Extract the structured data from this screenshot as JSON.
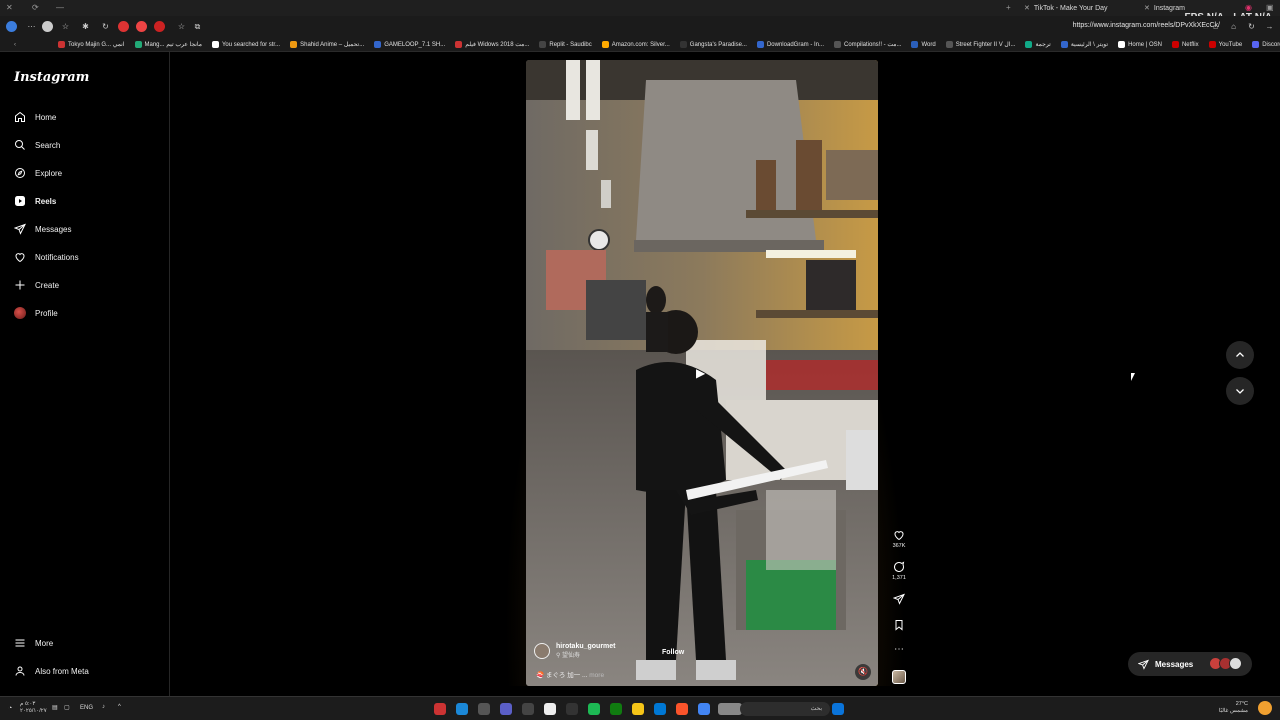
{
  "browser": {
    "tabs": [
      {
        "title": "TikTok - Make Your Day"
      },
      {
        "title": "Instagram"
      }
    ],
    "fps_label": "FPS",
    "fps_value": "N/A",
    "lat_label": "LAT",
    "lat_value": "N/A",
    "url": "https://www.instagram.com/reels/DPvXkXEcCk/",
    "bookmarks": [
      "Tokyo Majin G... انمي",
      "Mang... مانجا عرب تيم",
      "You searched for str...",
      "Shahid Anime – تحميل...",
      "GAMELOOP_7.1 SH...",
      "فيلم Widows 2018 مت...",
      "Replit - Saudibc",
      "Amazon.com: Silver...",
      "Gangsta's Paradise...",
      "DownloadGram - In...",
      "Compilations!! - مت...",
      "Word",
      "Street Fighter II V ال...",
      "ترجمة",
      "تويتر \\ الرئيسية",
      "Home | OSN",
      "Netflix",
      "YouTube",
      "Discord"
    ]
  },
  "sidebar": {
    "logo": "Instagram",
    "items": [
      {
        "label": "Home",
        "icon": "home-icon"
      },
      {
        "label": "Search",
        "icon": "search-icon"
      },
      {
        "label": "Explore",
        "icon": "compass-icon"
      },
      {
        "label": "Reels",
        "icon": "reels-icon",
        "active": true
      },
      {
        "label": "Messages",
        "icon": "send-icon"
      },
      {
        "label": "Notifications",
        "icon": "heart-icon"
      },
      {
        "label": "Create",
        "icon": "plus-icon"
      },
      {
        "label": "Profile",
        "icon": "avatar"
      }
    ],
    "bottom": [
      {
        "label": "More",
        "icon": "menu-icon"
      },
      {
        "label": "Also from Meta",
        "icon": "meta-icon"
      }
    ]
  },
  "reel": {
    "author": "hirotaku_gourmet",
    "location": "⚲ 望仙寿",
    "follow_label": "Follow",
    "caption": "🍣 まぐろ 加一 ...",
    "caption_more": "more",
    "likes": "367K",
    "comments": "1,371"
  },
  "messages_pill": {
    "label": "Messages"
  },
  "taskbar": {
    "time": "٥:٠٣ م",
    "date": "٢٠٢٥/١٠/٢٧",
    "lang": "ENG",
    "search_placeholder": "بحث",
    "weather_temp": "27°C",
    "weather_desc": "مشمس غالبًا"
  },
  "colors": {
    "background": "#000000",
    "sidebar_border": "#262626",
    "button_bg": "#262626",
    "glow": "#ffa028"
  }
}
